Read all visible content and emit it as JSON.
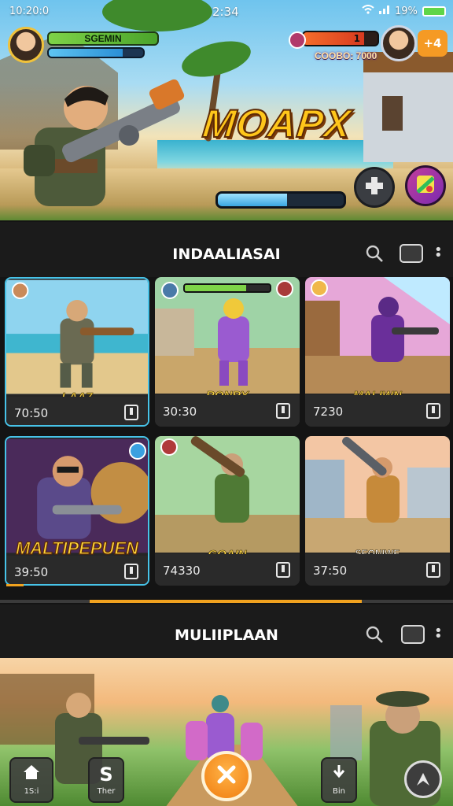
{
  "status_bar": {
    "left_text": "10:20:0",
    "time": "2:34",
    "battery_text": "19%"
  },
  "header": {
    "player_name": "SGEMIN",
    "player_hp": 0.78,
    "enemy_counter": "1",
    "enemy_hp": 0.82,
    "score_text": "COOBO: 7000",
    "add_label": "+4"
  },
  "hero": {
    "game_title": "MOAPX",
    "loading_progress": 0.55
  },
  "section1": {
    "title": "INDAALIASAI"
  },
  "cards": [
    {
      "label": "LAA7",
      "value": "70:50",
      "art": "beach-soldier"
    },
    {
      "label": "RONRY",
      "value": "30:30",
      "art": "purple-fighter"
    },
    {
      "label": "MALIWN",
      "value": "7230",
      "art": "purple-soldier"
    },
    {
      "label": "MALTIPEPUEN",
      "value": "39:50",
      "art": "glasses-gunner"
    },
    {
      "label": "GOAIN",
      "value": "74330",
      "art": "green-bazooka"
    },
    {
      "label": "SEONIWE",
      "value": "37:50",
      "art": "village-soldier"
    }
  ],
  "scroll_progress": 0.6,
  "section2": {
    "title": "MULIIPLAAN"
  },
  "bottom_nav": {
    "home_label": "1S:i",
    "shop_label": "Ther",
    "shop_glyph": "S",
    "down_label": "Bin"
  },
  "colors": {
    "accent_orange": "#f1a21f",
    "card_highlight": "#47c3e8",
    "title_yellow": "#ffc61a"
  }
}
